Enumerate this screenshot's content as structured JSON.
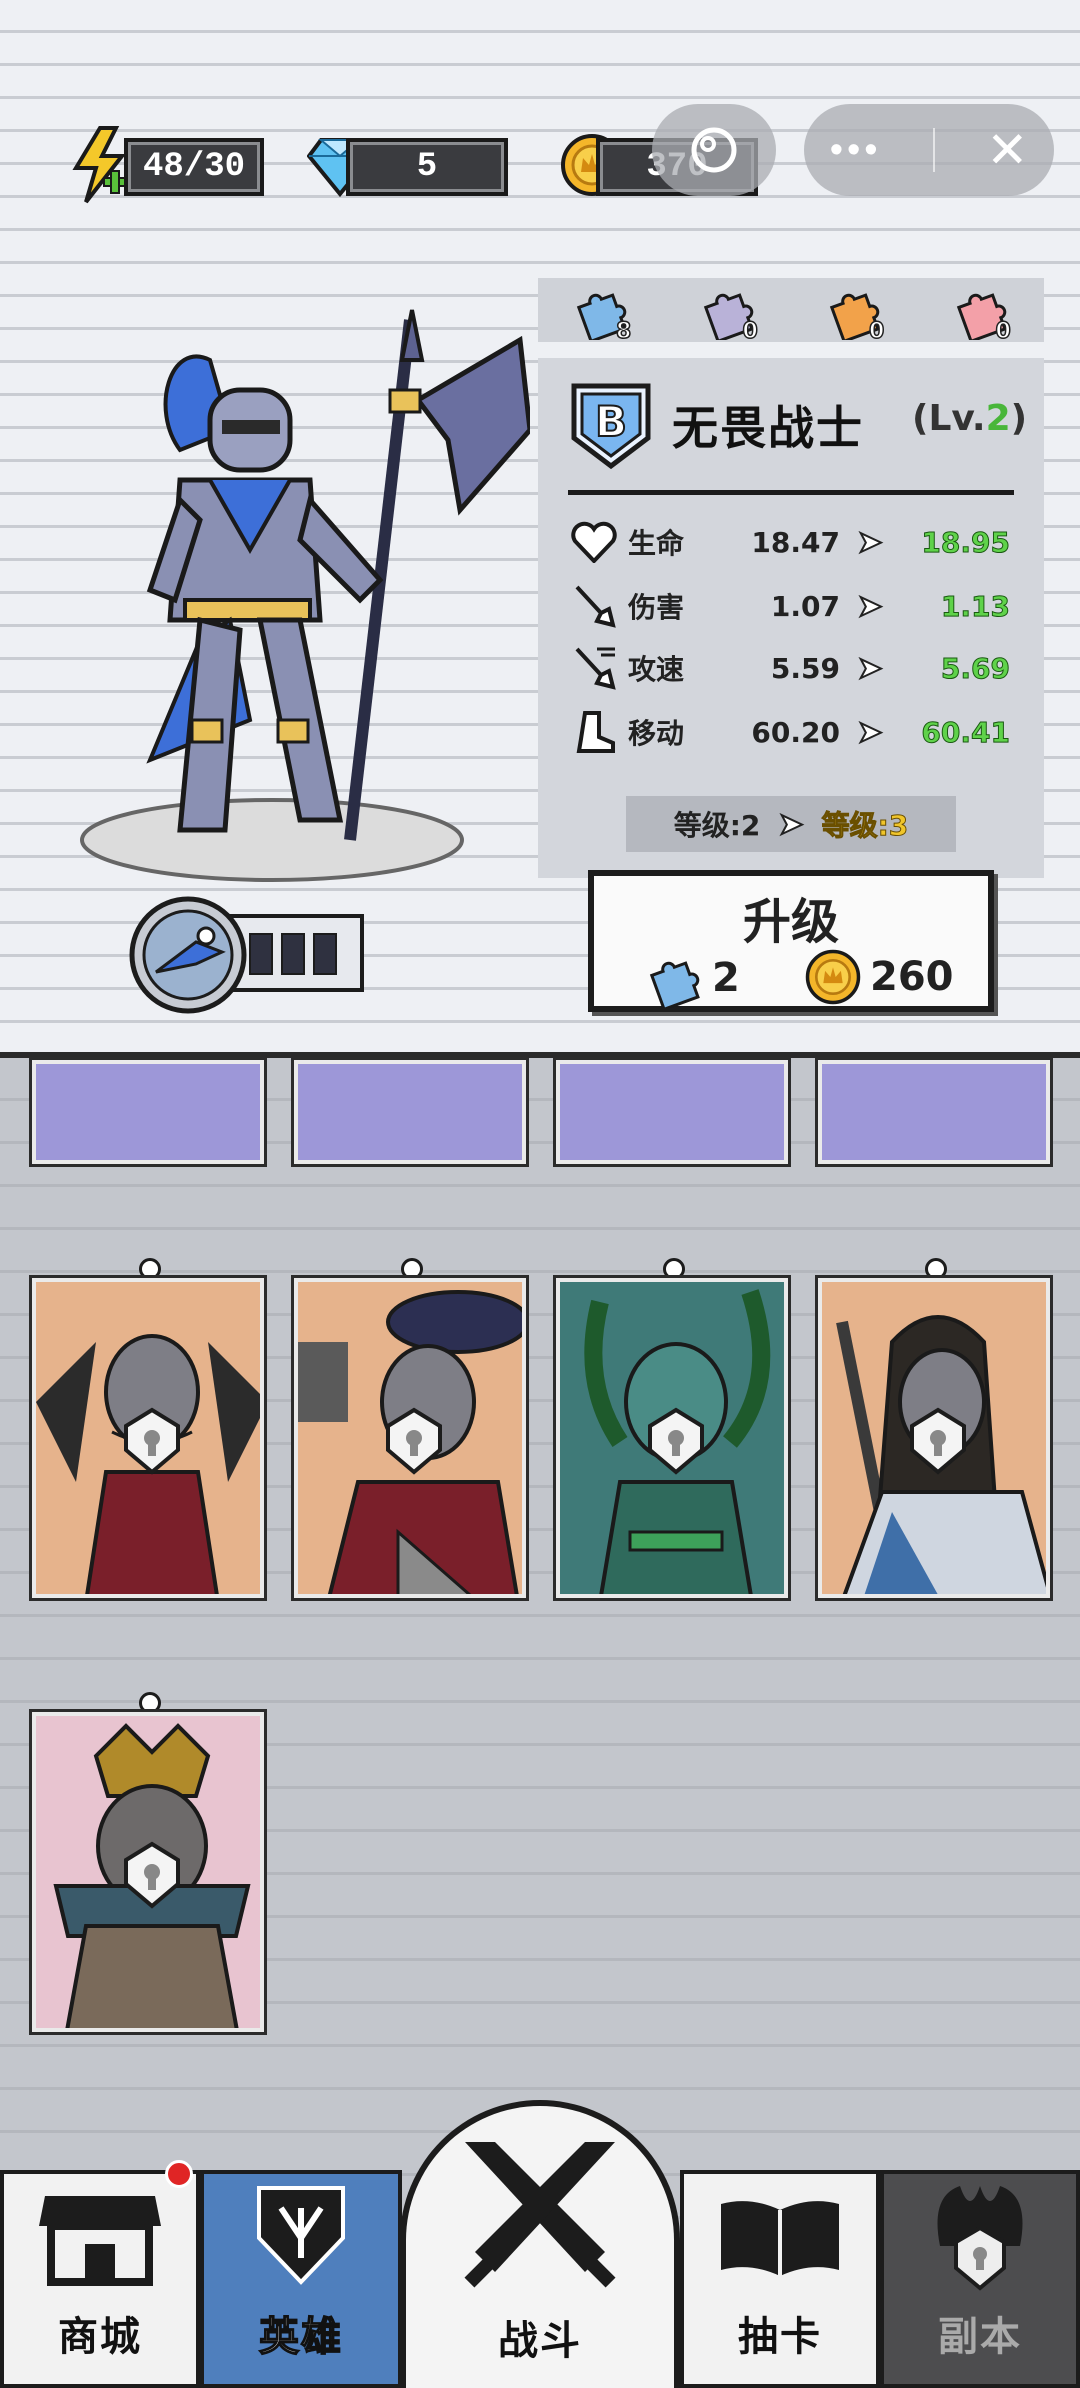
{
  "resources": {
    "energy": "48/30",
    "diamonds": "5",
    "gold": "370"
  },
  "capsule": {
    "more_icon": "more-dots-icon",
    "close_icon": "close-icon"
  },
  "puzzles": [
    {
      "color": "#7fb8e8",
      "count": "8"
    },
    {
      "color": "#b9b2d8",
      "count": "0"
    },
    {
      "color": "#f2a24a",
      "count": "0"
    },
    {
      "color": "#f3a0a8",
      "count": "0"
    }
  ],
  "hero": {
    "rank": "B",
    "name": "无畏战士",
    "lv_prefix": "(Lv.",
    "lv_value": "2",
    "lv_suffix": ")"
  },
  "stats": [
    {
      "icon": "heart-icon",
      "name": "生命",
      "current": "18.47",
      "next": "18.95"
    },
    {
      "icon": "sword-icon",
      "name": "伤害",
      "current": "1.07",
      "next": "1.13"
    },
    {
      "icon": "speed-sword-icon",
      "name": "攻速",
      "current": "5.59",
      "next": "5.69"
    },
    {
      "icon": "boot-icon",
      "name": "移动",
      "current": "60.20",
      "next": "60.41"
    }
  ],
  "level": {
    "current": "等级:2",
    "next": "等级:3"
  },
  "upgrade": {
    "label": "升级",
    "puzzle_cost": "2",
    "gold_cost": "260"
  },
  "skill": {
    "pips": 3
  },
  "nav": {
    "shop": "商城",
    "heroes": "英雄",
    "battle": "战斗",
    "gacha": "抽卡",
    "dungeon": "副本"
  },
  "colors": {
    "accent_blue": "#4f7fbd",
    "stat_green": "#5fd24a",
    "level_gold": "#f0c52a",
    "badge_red": "#e02525"
  }
}
